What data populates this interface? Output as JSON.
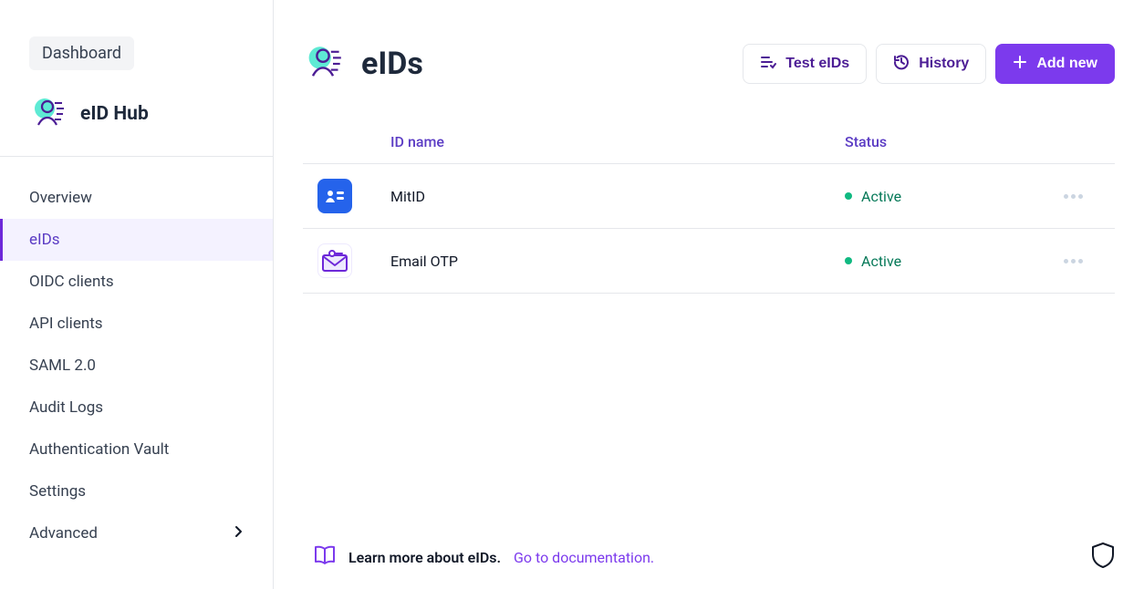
{
  "sidebar": {
    "badge": "Dashboard",
    "brand": "eID Hub",
    "items": [
      {
        "label": "Overview"
      },
      {
        "label": "eIDs"
      },
      {
        "label": "OIDC clients"
      },
      {
        "label": "API clients"
      },
      {
        "label": "SAML 2.0"
      },
      {
        "label": "Audit Logs"
      },
      {
        "label": "Authentication Vault"
      },
      {
        "label": "Settings"
      },
      {
        "label": "Advanced"
      }
    ]
  },
  "header": {
    "title": "eIDs",
    "test_label": "Test eIDs",
    "history_label": "History",
    "add_label": "Add new"
  },
  "table": {
    "cols": {
      "name": "ID name",
      "status": "Status"
    },
    "rows": [
      {
        "name": "MitID",
        "status": "Active"
      },
      {
        "name": "Email OTP",
        "status": "Active"
      }
    ]
  },
  "footer": {
    "learn": "Learn more about eIDs.",
    "doc_link": "Go to documentation."
  }
}
